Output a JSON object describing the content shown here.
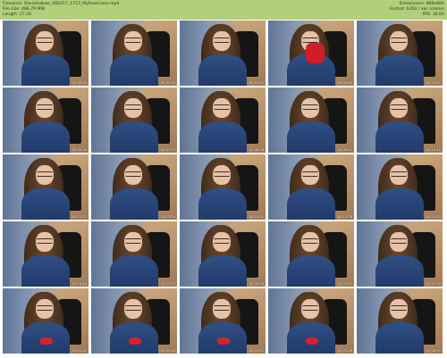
{
  "header": {
    "filename_line": "Filename: OliviaAubree_060317_1717_MyFreeCams.mp4",
    "filesize_line": "File size: 486.79 MiB",
    "length_line": "Length: 27:16",
    "dimensions_line": "Dimensions: 880x660",
    "format_line": "Format: h264 / aac (mono)",
    "fps_line": "FPS: 30.00"
  },
  "colors": {
    "header_bg": "#b2cf7a",
    "bra_red": "#d8202a",
    "jacket_blue": "#2f4f83"
  },
  "thumbnails": [
    {
      "timestamp": "00:00:31",
      "variant": "normal"
    },
    {
      "timestamp": "00:01:36",
      "variant": "normal"
    },
    {
      "timestamp": "00:02:41",
      "variant": "normal"
    },
    {
      "timestamp": "00:03:46",
      "variant": "mug"
    },
    {
      "timestamp": "00:04:51",
      "variant": "normal"
    },
    {
      "timestamp": "00:05:56",
      "variant": "normal"
    },
    {
      "timestamp": "00:07:01",
      "variant": "normal"
    },
    {
      "timestamp": "00:08:06",
      "variant": "normal"
    },
    {
      "timestamp": "00:09:11",
      "variant": "normal"
    },
    {
      "timestamp": "00:10:16",
      "variant": "normal"
    },
    {
      "timestamp": "00:11:21",
      "variant": "normal"
    },
    {
      "timestamp": "00:12:26",
      "variant": "normal"
    },
    {
      "timestamp": "00:13:31",
      "variant": "normal"
    },
    {
      "timestamp": "00:14:36",
      "variant": "normal"
    },
    {
      "timestamp": "00:15:41",
      "variant": "normal"
    },
    {
      "timestamp": "00:16:46",
      "variant": "normal"
    },
    {
      "timestamp": "00:17:51",
      "variant": "normal"
    },
    {
      "timestamp": "00:18:56",
      "variant": "normal"
    },
    {
      "timestamp": "00:20:01",
      "variant": "normal"
    },
    {
      "timestamp": "00:21:06",
      "variant": "normal"
    },
    {
      "timestamp": "00:22:11",
      "variant": "red"
    },
    {
      "timestamp": "00:23:16",
      "variant": "red"
    },
    {
      "timestamp": "00:24:21",
      "variant": "red"
    },
    {
      "timestamp": "00:25:26",
      "variant": "red"
    },
    {
      "timestamp": "00:26:31",
      "variant": "normal"
    }
  ]
}
